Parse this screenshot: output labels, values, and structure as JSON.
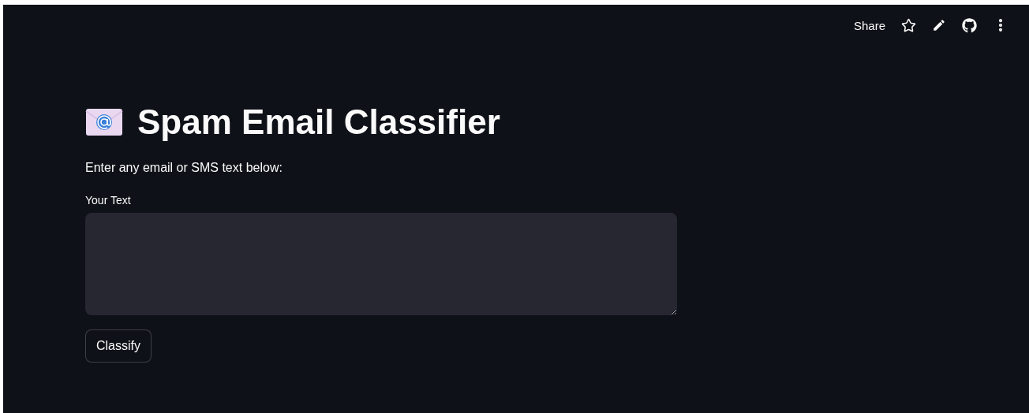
{
  "header": {
    "share": "Share"
  },
  "title": "Spam Email Classifier",
  "description": "Enter any email or SMS text below:",
  "text_input": {
    "label": "Your Text"
  },
  "button": "Classify"
}
